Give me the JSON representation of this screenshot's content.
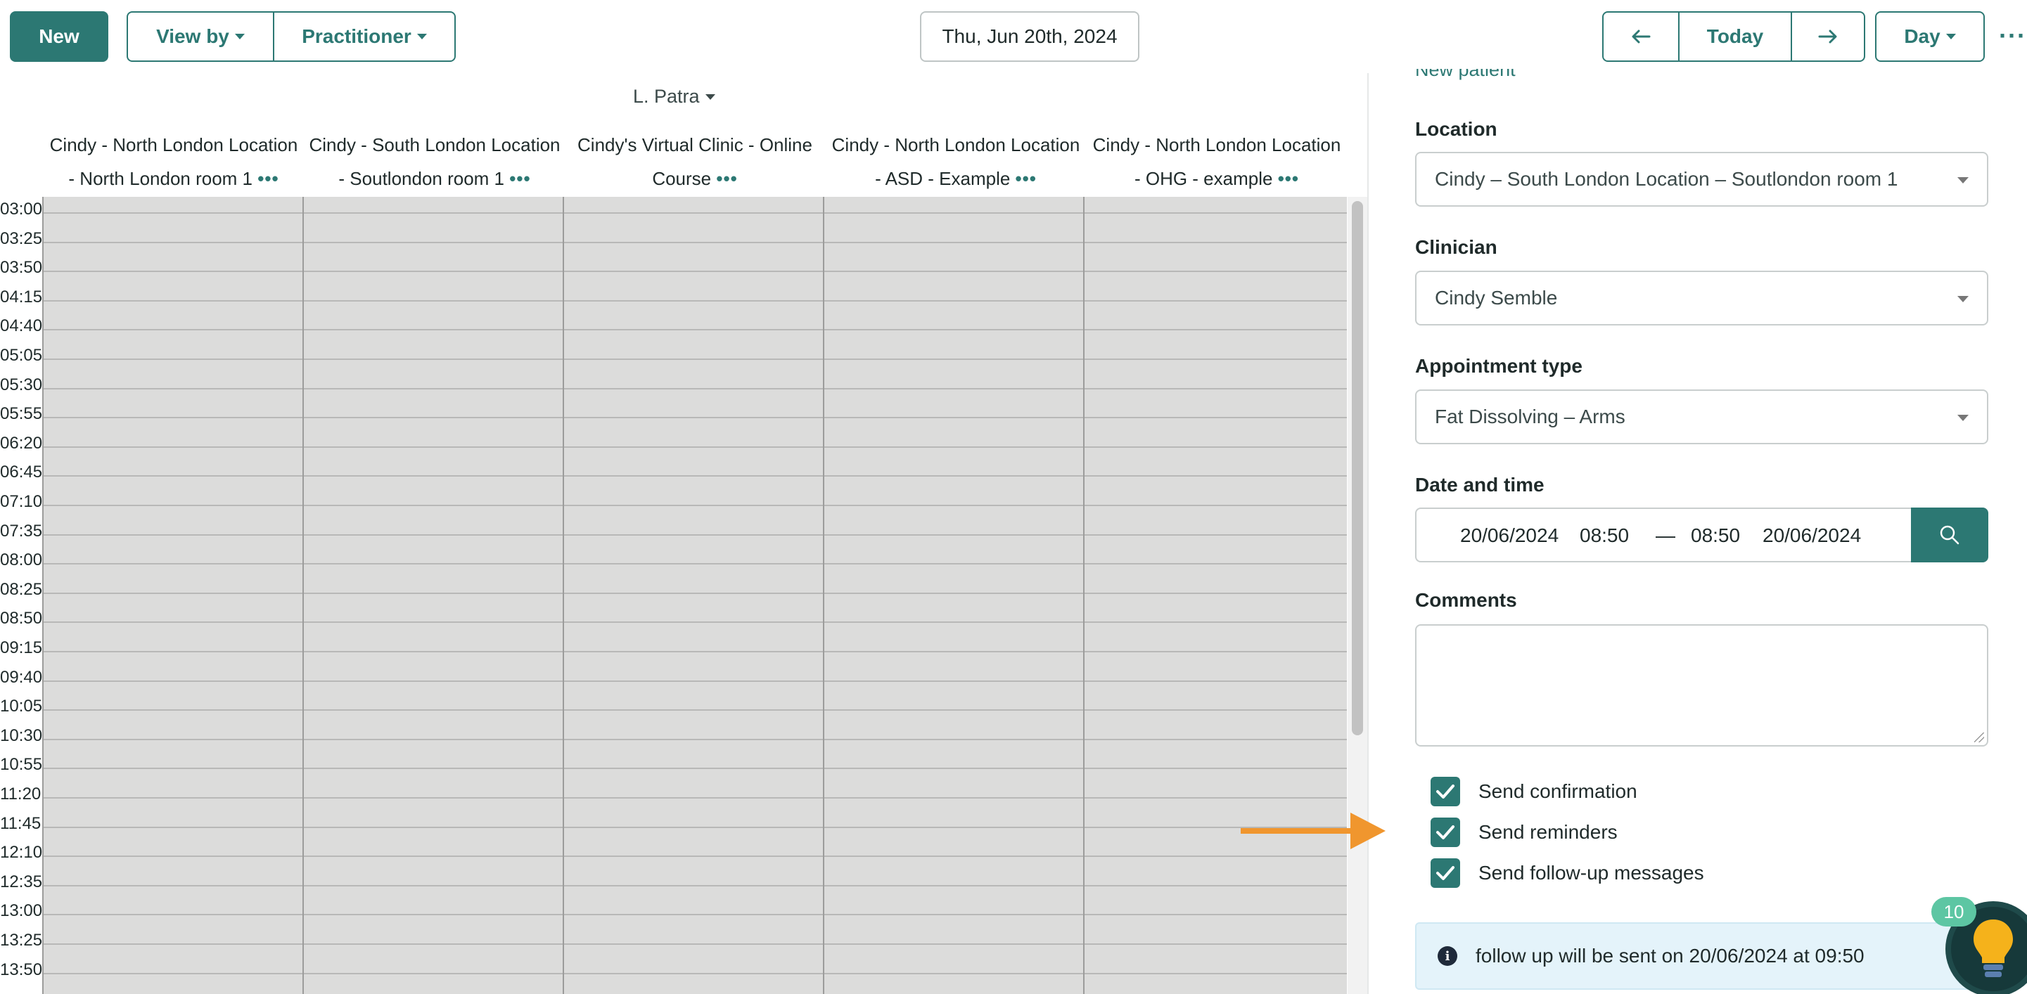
{
  "toolbar": {
    "new_label": "New",
    "view_by_label": "View by",
    "practitioner_label": "Practitioner",
    "date": "Thu, Jun 20th, 2024",
    "prev_icon": "arrow-left-icon",
    "today_label": "Today",
    "next_icon": "arrow-right-icon",
    "view_mode": "Day",
    "more_icon": "more-dots-icon"
  },
  "calendar": {
    "practitioner": "L. Patra",
    "columns": [
      {
        "line1": "Cindy - North London Location",
        "line2": "- North London room 1",
        "dots": "•••"
      },
      {
        "line1": "Cindy - South London Location",
        "line2": "- Soutlondon room 1",
        "dots": "•••"
      },
      {
        "line1": "Cindy's Virtual Clinic - Online",
        "line2": "Course",
        "dots": "•••"
      },
      {
        "line1": "Cindy - North London Location",
        "line2": "- ASD - Example",
        "dots": "•••"
      },
      {
        "line1": "Cindy - North London Location",
        "line2": "- OHG - example",
        "dots": "•••"
      }
    ],
    "times": [
      "03:00",
      "03:25",
      "03:50",
      "04:15",
      "04:40",
      "05:05",
      "05:30",
      "05:55",
      "06:20",
      "06:45",
      "07:10",
      "07:35",
      "08:00",
      "08:25",
      "08:50",
      "09:15",
      "09:40",
      "10:05",
      "10:30",
      "10:55",
      "11:20",
      "11:45",
      "12:10",
      "12:35",
      "13:00",
      "13:25",
      "13:50"
    ]
  },
  "form": {
    "new_patient_link": "New patient",
    "location_label": "Location",
    "location_value": "Cindy – South London Location – Soutlondon room 1",
    "clinician_label": "Clinician",
    "clinician_value": "Cindy Semble",
    "appointment_type_label": "Appointment type",
    "appointment_type_value": "Fat Dissolving – Arms",
    "datetime_label": "Date and time",
    "start_date": "20/06/2024",
    "start_time": "08:50",
    "separator": "—",
    "end_time": "08:50",
    "end_date": "20/06/2024",
    "comments_label": "Comments",
    "checkboxes": [
      {
        "label": "Send confirmation",
        "checked": true
      },
      {
        "label": "Send reminders",
        "checked": true
      },
      {
        "label": "Send follow-up messages",
        "checked": true
      }
    ],
    "info_text": "follow up will be sent on 20/06/2024 at 09:50"
  },
  "help_widget": {
    "badge_count": "10",
    "icon": "lightbulb-icon"
  },
  "colors": {
    "accent": "#2c7873",
    "grid_bg": "#dcdcdb",
    "annotation_arrow": "#f0962e",
    "info_bg": "#e4f3fa",
    "badge": "#5dc6a3"
  }
}
